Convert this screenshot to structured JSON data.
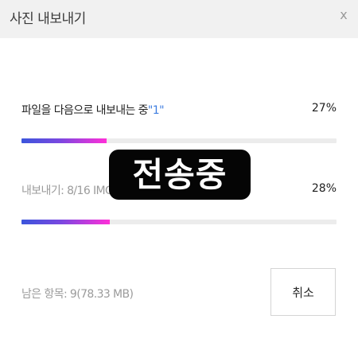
{
  "window": {
    "title": "사진 내보내기",
    "close_glyph": "x"
  },
  "current_file": {
    "label_prefix": "파일을 다음으로 내보내는 중",
    "quoted_name": "\"1\"",
    "percent_text": "27%",
    "progress": 0.27
  },
  "overall": {
    "label": "내보내기: 8/16 IMG_0",
    "percent_text": "28%",
    "progress": 0.28
  },
  "overlay": {
    "text": "전송중"
  },
  "footer": {
    "remaining": "남은 항목: 9(78.33 MB)",
    "cancel_label": "취소"
  },
  "colors": {
    "progress_start": "#3b55dc",
    "progress_end": "#ff2fd8",
    "track": "#ececec",
    "accent_text": "#3f7ee0",
    "titlebar_bg": "#f1f1f1"
  }
}
